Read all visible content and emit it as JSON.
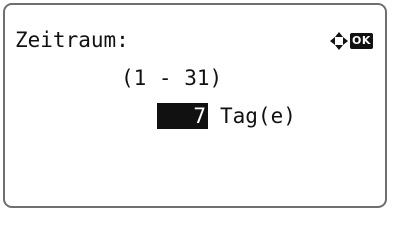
{
  "screen": {
    "title": "Zeitraum:",
    "range_label": "(1 - 31)",
    "value": "7",
    "unit": "Tag(e)",
    "ok_label": "OK",
    "nav_icon": "four-way-arrow-icon"
  }
}
